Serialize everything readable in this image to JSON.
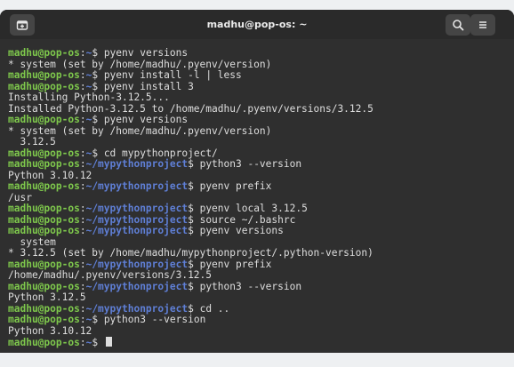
{
  "window": {
    "title": "madhu@pop-os: ~",
    "new_tab_icon": "new-tab-icon",
    "search_icon": "search-icon",
    "menu_icon": "hamburger-menu-icon"
  },
  "colors": {
    "terminal_bg": "#2f2f2f",
    "prompt_user": "#7ec84c",
    "prompt_path": "#5f7fd6",
    "text": "#dedede"
  },
  "terminal": {
    "lines": [
      {
        "kind": "cmd",
        "user": "madhu@pop-os",
        "path": "~",
        "command": " pyenv versions"
      },
      {
        "kind": "out",
        "text": "* system (set by /home/madhu/.pyenv/version)"
      },
      {
        "kind": "cmd",
        "user": "madhu@pop-os",
        "path": "~",
        "command": " pyenv install -l | less"
      },
      {
        "kind": "cmd",
        "user": "madhu@pop-os",
        "path": "~",
        "command": " pyenv install 3"
      },
      {
        "kind": "out",
        "text": "Installing Python-3.12.5..."
      },
      {
        "kind": "out",
        "text": "Installed Python-3.12.5 to /home/madhu/.pyenv/versions/3.12.5"
      },
      {
        "kind": "cmd",
        "user": "madhu@pop-os",
        "path": "~",
        "command": " pyenv versions"
      },
      {
        "kind": "out",
        "text": "* system (set by /home/madhu/.pyenv/version)"
      },
      {
        "kind": "out",
        "text": "  3.12.5"
      },
      {
        "kind": "cmd",
        "user": "madhu@pop-os",
        "path": "~",
        "command": " cd mypythonproject/"
      },
      {
        "kind": "cmd",
        "user": "madhu@pop-os",
        "path": "~/mypythonproject",
        "command": " python3 --version"
      },
      {
        "kind": "out",
        "text": "Python 3.10.12"
      },
      {
        "kind": "cmd",
        "user": "madhu@pop-os",
        "path": "~/mypythonproject",
        "command": " pyenv prefix"
      },
      {
        "kind": "out",
        "text": "/usr"
      },
      {
        "kind": "cmd",
        "user": "madhu@pop-os",
        "path": "~/mypythonproject",
        "command": " pyenv local 3.12.5"
      },
      {
        "kind": "cmd",
        "user": "madhu@pop-os",
        "path": "~/mypythonproject",
        "command": " source ~/.bashrc"
      },
      {
        "kind": "cmd",
        "user": "madhu@pop-os",
        "path": "~/mypythonproject",
        "command": " pyenv versions"
      },
      {
        "kind": "out",
        "text": "  system"
      },
      {
        "kind": "out",
        "text": "* 3.12.5 (set by /home/madhu/mypythonproject/.python-version)"
      },
      {
        "kind": "cmd",
        "user": "madhu@pop-os",
        "path": "~/mypythonproject",
        "command": " pyenv prefix"
      },
      {
        "kind": "out",
        "text": "/home/madhu/.pyenv/versions/3.12.5"
      },
      {
        "kind": "cmd",
        "user": "madhu@pop-os",
        "path": "~/mypythonproject",
        "command": " python3 --version"
      },
      {
        "kind": "out",
        "text": "Python 3.12.5"
      },
      {
        "kind": "cmd",
        "user": "madhu@pop-os",
        "path": "~/mypythonproject",
        "command": " cd .."
      },
      {
        "kind": "cmd",
        "user": "madhu@pop-os",
        "path": "~",
        "command": " python3 --version"
      },
      {
        "kind": "out",
        "text": "Python 3.10.12"
      },
      {
        "kind": "cmd",
        "user": "madhu@pop-os",
        "path": "~",
        "command": " ",
        "cursor": true
      }
    ]
  }
}
